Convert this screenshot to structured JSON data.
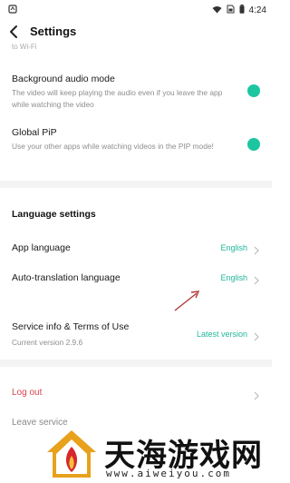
{
  "status_bar": {
    "time": "4:24",
    "left_icon": "app-logo-icon",
    "icons": [
      "wifi-icon",
      "sim-icon",
      "battery-icon"
    ]
  },
  "header": {
    "title": "Settings",
    "back_icon": "back-arrow-icon"
  },
  "faded_top": "to Wi-Fi",
  "settings": {
    "background_audio": {
      "title": "Background audio mode",
      "description": "The video will keep playing the audio even if you leave the app while watching the video",
      "enabled": true
    },
    "global_pip": {
      "title": "Global PiP",
      "description": "Use your other apps while watching videos in the PIP mode!",
      "enabled": true
    }
  },
  "language_section": {
    "heading": "Language settings",
    "items": [
      {
        "label": "App language",
        "value": "English"
      },
      {
        "label": "Auto-translation language",
        "value": "English"
      }
    ]
  },
  "service": {
    "title": "Service info & Terms of Use",
    "subtitle": "Current version 2.9.6",
    "value": "Latest version"
  },
  "account": {
    "logout": "Log out",
    "leave": "Leave service"
  },
  "watermark": {
    "name": "天海游戏网",
    "url": "www.aiweiyou.com"
  },
  "colors": {
    "accent": "#1bc6a0",
    "link": "#22b79a",
    "danger": "#d9434e",
    "annotation_arrow": "#b03a3a"
  }
}
